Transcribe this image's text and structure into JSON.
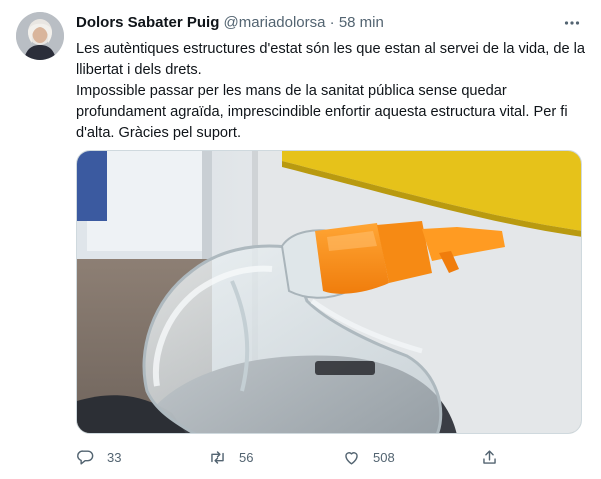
{
  "tweet": {
    "author_name": "Dolors Sabater Puig",
    "handle": "@mariadolorsa",
    "separator": "·",
    "time": "58 min",
    "paragraph1": "Les autèntiques estructures d'estat són les que estan al servei de la vida, de la llibertat i dels drets.",
    "paragraph2": "Impossible passar per les mans de la sanitat pública sense quedar profundament agraïda, imprescindible enfortir aquesta estructura vital. Per fi d'alta. Gràcies pel suport."
  },
  "actions": {
    "replies": "33",
    "retweets": "56",
    "likes": "508"
  },
  "colors": {
    "text": "#0f1419",
    "secondary": "#536471",
    "border": "#cfd9de",
    "mask_orange": "#f7931e",
    "rail_yellow": "#e8c41a"
  },
  "icons": [
    "avatar",
    "more-icon",
    "reply-icon",
    "retweet-icon",
    "like-icon",
    "share-icon"
  ]
}
